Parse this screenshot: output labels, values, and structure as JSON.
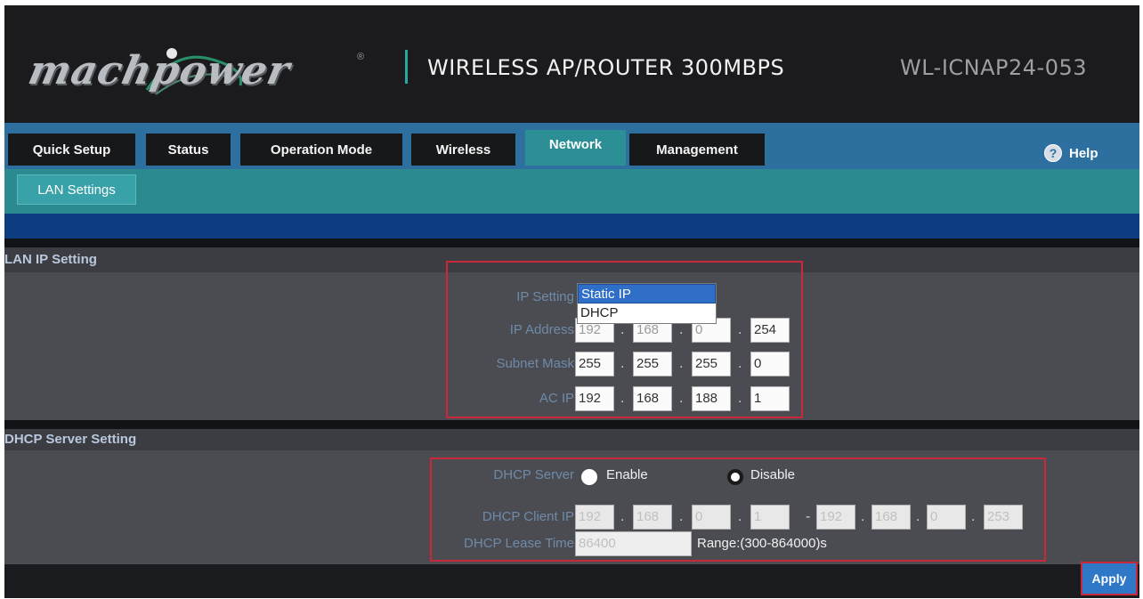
{
  "header": {
    "logo_text": "machpower",
    "logo_reg": "®",
    "product_title": "WIRELESS AP/ROUTER 300MBPS",
    "model": "WL-ICNAP24-053"
  },
  "nav": {
    "tabs": [
      {
        "label": "Quick Setup"
      },
      {
        "label": "Status"
      },
      {
        "label": "Operation Mode"
      },
      {
        "label": "Wireless"
      },
      {
        "label": "Network",
        "active": true
      },
      {
        "label": "Management"
      }
    ],
    "help_label": "Help",
    "help_icon": "?"
  },
  "subnav": {
    "label": "LAN Settings"
  },
  "lan": {
    "title": "LAN IP Setting",
    "ip_setting_label": "IP Setting",
    "ip_setting_options": [
      "Static IP",
      "DHCP"
    ],
    "ip_setting_selected": "Static IP",
    "ip_address_label": "IP Address",
    "ip_address": [
      "192",
      "168",
      "0",
      "254"
    ],
    "subnet_label": "Subnet Mask",
    "subnet": [
      "255",
      "255",
      "255",
      "0"
    ],
    "ac_ip_label": "AC IP",
    "ac_ip": [
      "192",
      "168",
      "188",
      "1"
    ]
  },
  "dhcp": {
    "title": "DHCP Server Setting",
    "server_label": "DHCP Server",
    "enable_label": "Enable",
    "disable_label": "Disable",
    "selected": "Disable",
    "client_label": "DHCP Client IP",
    "client_start": [
      "192",
      "168",
      "0",
      "1"
    ],
    "client_end": [
      "192",
      "168",
      "0",
      "253"
    ],
    "lease_label": "DHCP Lease Time",
    "lease_value": "86400",
    "range_text": "Range:(300-864000)s"
  },
  "apply_label": "Apply",
  "colors": {
    "nav_bg": "#2d6f9f",
    "accent_teal": "#2a8a90",
    "highlight_red": "#c8283a"
  }
}
